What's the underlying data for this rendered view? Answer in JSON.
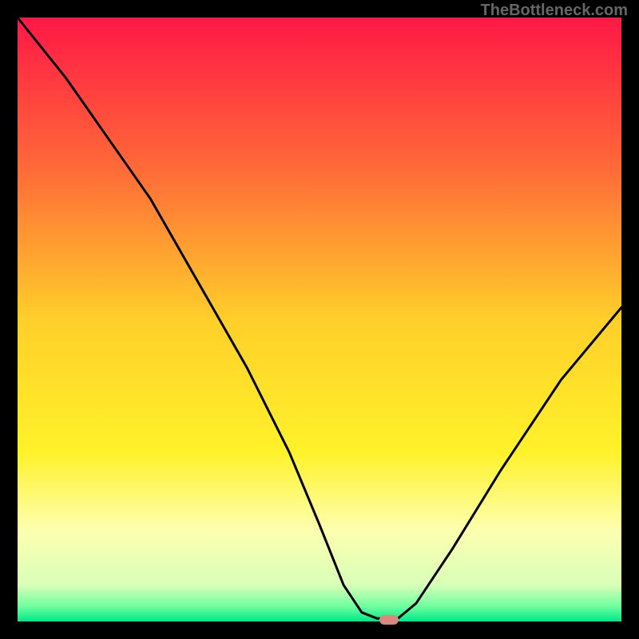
{
  "watermark": "TheBottleneck.com",
  "chart_data": {
    "type": "line",
    "title": "",
    "xlabel": "",
    "ylabel": "",
    "xlim": [
      0,
      100
    ],
    "ylim": [
      0,
      100
    ],
    "gradient_stops": [
      {
        "offset": 0.0,
        "color": "#ff1846"
      },
      {
        "offset": 0.25,
        "color": "#ff6a38"
      },
      {
        "offset": 0.5,
        "color": "#ffcf2a"
      },
      {
        "offset": 0.72,
        "color": "#fff22a"
      },
      {
        "offset": 0.85,
        "color": "#fdffb0"
      },
      {
        "offset": 0.94,
        "color": "#d8ffb8"
      },
      {
        "offset": 0.975,
        "color": "#6fff9e"
      },
      {
        "offset": 1.0,
        "color": "#00e888"
      }
    ],
    "series": [
      {
        "name": "bottleneck-curve",
        "x": [
          0,
          8,
          15,
          22,
          30,
          38,
          45,
          50,
          54,
          57,
          59.5,
          63,
          66,
          72,
          80,
          90,
          100
        ],
        "y": [
          100,
          90,
          80,
          70,
          56,
          42,
          28,
          16,
          6,
          1.5,
          0.5,
          0.5,
          3,
          12,
          25,
          40,
          52
        ]
      }
    ],
    "marker": {
      "x": 61.5,
      "y": 0.3,
      "color": "#d98a7f"
    },
    "curve_color": "#000000",
    "curve_width": 3
  }
}
